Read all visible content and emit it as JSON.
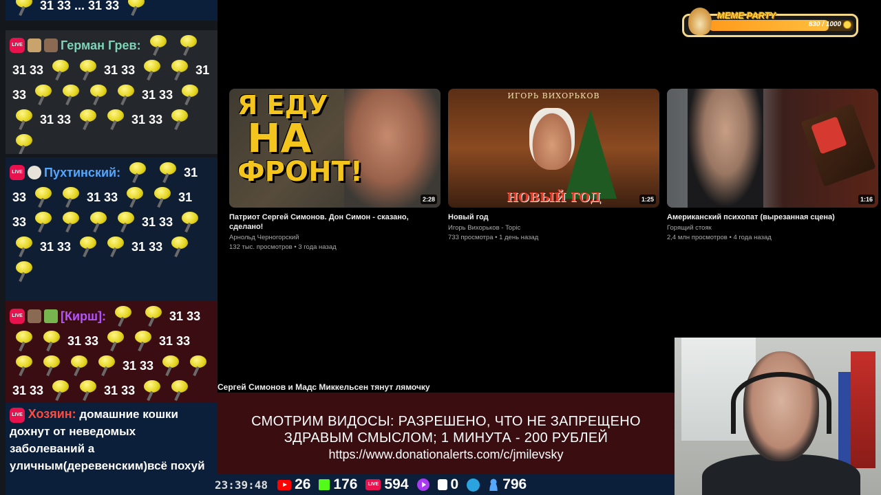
{
  "chat": {
    "top_partial": "31 33 ... 31 33",
    "messages": [
      {
        "user": "Герман Грев:",
        "user_color": "#7fd2b5",
        "bg": "#24272c",
        "nums": [
          "31 33",
          "31 33",
          "31",
          "33",
          "31 33",
          "31 33",
          "31 33"
        ]
      },
      {
        "user": "Пухтинский:",
        "user_color": "#53a7ff",
        "bg": "#0f1e33",
        "nums": [
          "31",
          "33",
          "31 33",
          "31",
          "33",
          "31 33",
          "31 33",
          "31 33"
        ]
      },
      {
        "user": "[Кирш]:",
        "user_color": "#b453ff",
        "bg": "#3a0d12",
        "nums": [
          "31 33",
          "31 33",
          "31 33",
          "31 33",
          "31 33",
          "31 33"
        ]
      },
      {
        "user": "Хозяин:",
        "user_color": "#ff4a3d",
        "bg": "#0b1f3a",
        "text": "домашние кошки дохнут от неведомых заболеваний а уличным(деревенским)всё похуй"
      }
    ]
  },
  "videos": [
    {
      "thumb_text": [
        "Я ЕДУ",
        "НА",
        "ФРОНТ!"
      ],
      "duration": "2:28",
      "title": "Патриот Сергей Симонов. Дон Симон - сказано, сделано!",
      "channel": "Арнольд Черногорский",
      "stats": "132 тыс. просмотров • 3 года назад"
    },
    {
      "thumb_header": "ИГОРЬ ВИХОРЬКОВ",
      "thumb_footer": "НОВЫЙ ГОД",
      "duration": "1:25",
      "title": "Новый год",
      "channel": "Игорь Вихорьков - Topic",
      "stats": "733 просмотра • 1 день назад"
    },
    {
      "duration": "1:16",
      "title": "Американский психопат (вырезанная сцена)",
      "channel": "Горящий стояк",
      "stats": "2,4 млн просмотров • 4 года назад"
    }
  ],
  "caption": "Сергей Симонов и Мадс Миккельсен тянут лямочку",
  "info": {
    "line1": "СМОТРИМ ВИДОСЫ: РАЗРЕШЕНО, ЧТО НЕ ЗАПРЕЩЕНО",
    "line2": "ЗДРАВЫМ СМЫСЛОМ; 1 МИНУТА - 200 РУБЛЕЙ",
    "url": "https://www.donationalerts.com/c/jmilevsky"
  },
  "status": {
    "clock": "23:39:48",
    "stats": [
      {
        "icon": "youtube-icon",
        "value": "26"
      },
      {
        "icon": "kick-icon",
        "value": "176"
      },
      {
        "icon": "live-icon",
        "value": "594"
      },
      {
        "icon": "vk-video-icon",
        "value": ""
      },
      {
        "icon": "rutube-icon",
        "value": "0"
      },
      {
        "icon": "telegram-icon",
        "value": ""
      },
      {
        "icon": "viewers-icon",
        "value": "796"
      }
    ]
  },
  "meme_party": {
    "title": "MEME PARTY",
    "current": 830,
    "max": 1000,
    "progress_text": "830 / 1000"
  },
  "colors": {
    "accent_yellow": "#f3c51d",
    "live_red": "#e8134e",
    "info_bg": "#3a0d10",
    "status_bg": "#0b1f3a"
  }
}
